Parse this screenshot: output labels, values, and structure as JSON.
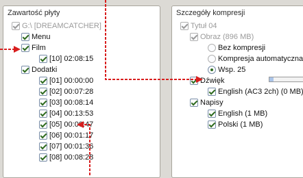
{
  "left_panel": {
    "title": "Zawartość płyty",
    "root": "G:\\ [DREAMCATCHER]",
    "menu": "Menu",
    "film": "Film",
    "film_child": "[10] 02:08:15",
    "extras": "Dodatki",
    "extras_items": [
      "[01] 00:00:00",
      "[02] 00:07:28",
      "[03] 00:08:14",
      "[04] 00:13:53",
      "[05] 00:00:47",
      "[06] 00:01:17",
      "[07] 00:01:36",
      "[08] 00:08:28"
    ]
  },
  "right_panel": {
    "title": "Szczegóły kompresji",
    "title_node": "Tytuł 04",
    "image_node": "Obraz (896 MB)",
    "options": [
      "Bez kompresji",
      "Kompresja automatyczna",
      "Wsp. 25"
    ],
    "selected_option": "Wsp. 25",
    "slider_level_fraction": 0.12,
    "sound": "Dźwięk",
    "sound_track": "English (AC3 2ch) (0 MB)",
    "subtitles": "Napisy",
    "subtitle_tracks": [
      "English (1 MB)",
      "Polski (1 MB)"
    ]
  },
  "colors": {
    "annotation_arrow": "#d81e1e",
    "background": "#dcdad5",
    "checkmark": "#2f6b1f"
  }
}
